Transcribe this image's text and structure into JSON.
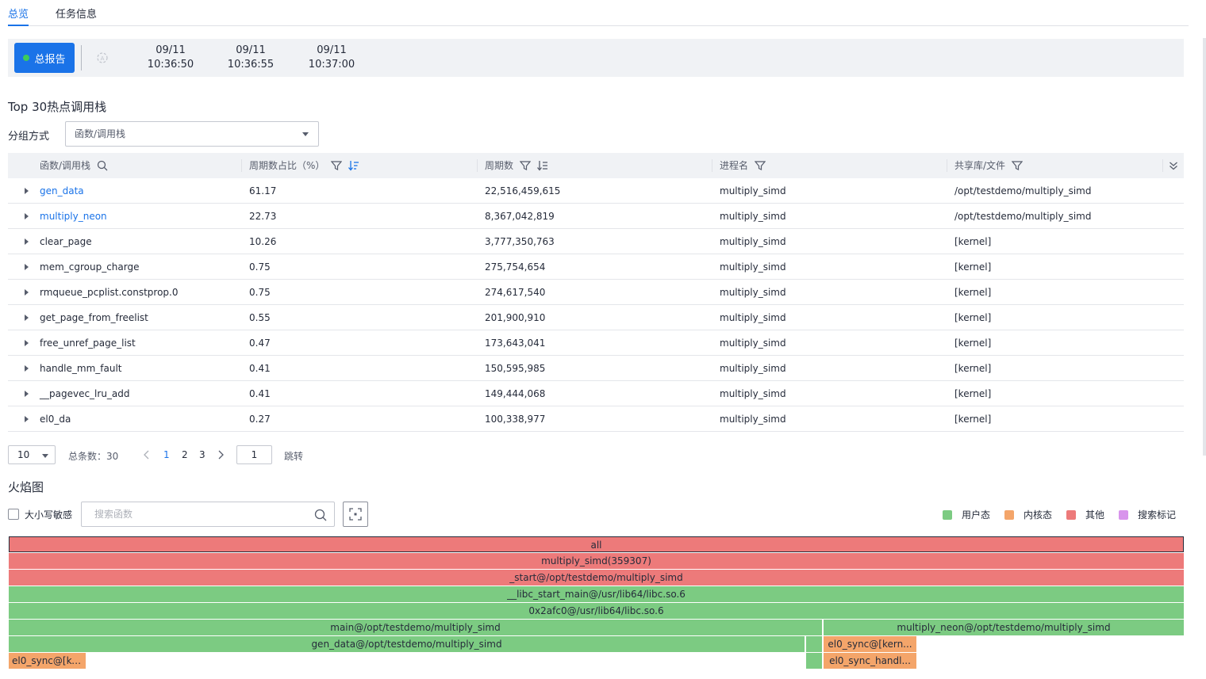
{
  "tabs": [
    {
      "label": "总览",
      "active": true
    },
    {
      "label": "任务信息",
      "active": false
    }
  ],
  "timeline": {
    "report_button": "总报告",
    "icon": "auto-icon",
    "points": [
      {
        "date": "09/11",
        "time": "10:36:50"
      },
      {
        "date": "09/11",
        "time": "10:36:55"
      },
      {
        "date": "09/11",
        "time": "10:37:00"
      }
    ]
  },
  "hotspot": {
    "title": "Top 30热点调用栈",
    "group_label": "分组方式",
    "group_value": "函数/调用栈",
    "columns": [
      "函数/调用栈",
      "周期数占比（%）",
      "周期数",
      "进程名",
      "共享库/文件"
    ],
    "rows": [
      {
        "func": "gen_data",
        "pct": "61.17",
        "cycles": "22,516,459,615",
        "proc": "multiply_simd",
        "lib": "/opt/testdemo/multiply_simd",
        "link": true
      },
      {
        "func": "multiply_neon",
        "pct": "22.73",
        "cycles": "8,367,042,819",
        "proc": "multiply_simd",
        "lib": "/opt/testdemo/multiply_simd",
        "link": true
      },
      {
        "func": "clear_page",
        "pct": "10.26",
        "cycles": "3,777,350,763",
        "proc": "multiply_simd",
        "lib": "[kernel]",
        "link": false
      },
      {
        "func": "mem_cgroup_charge",
        "pct": "0.75",
        "cycles": "275,754,654",
        "proc": "multiply_simd",
        "lib": "[kernel]",
        "link": false
      },
      {
        "func": "rmqueue_pcplist.constprop.0",
        "pct": "0.75",
        "cycles": "274,617,540",
        "proc": "multiply_simd",
        "lib": "[kernel]",
        "link": false
      },
      {
        "func": "get_page_from_freelist",
        "pct": "0.55",
        "cycles": "201,900,910",
        "proc": "multiply_simd",
        "lib": "[kernel]",
        "link": false
      },
      {
        "func": "free_unref_page_list",
        "pct": "0.47",
        "cycles": "173,643,041",
        "proc": "multiply_simd",
        "lib": "[kernel]",
        "link": false
      },
      {
        "func": "handle_mm_fault",
        "pct": "0.41",
        "cycles": "150,595,985",
        "proc": "multiply_simd",
        "lib": "[kernel]",
        "link": false
      },
      {
        "func": "__pagevec_lru_add",
        "pct": "0.41",
        "cycles": "149,444,068",
        "proc": "multiply_simd",
        "lib": "[kernel]",
        "link": false
      },
      {
        "func": "el0_da",
        "pct": "0.27",
        "cycles": "100,338,977",
        "proc": "multiply_simd",
        "lib": "[kernel]",
        "link": false
      }
    ]
  },
  "pagination": {
    "page_size": "10",
    "total": "总条数：30",
    "pages": [
      "1",
      "2",
      "3"
    ],
    "current": "1",
    "jump_value": "1",
    "jump_label": "跳转"
  },
  "flame": {
    "title": "火焰图",
    "case_label": "大小写敏感",
    "search_placeholder": "搜索函数",
    "legend": [
      {
        "label": "用户态",
        "color": "#7ccb82"
      },
      {
        "label": "内核态",
        "color": "#f4a56a"
      },
      {
        "label": "其他",
        "color": "#ed7a7a"
      },
      {
        "label": "搜索标记",
        "color": "#d894ec"
      }
    ],
    "frames": [
      {
        "label": "all",
        "kind": "other"
      },
      {
        "label": "multiply_simd(359307)",
        "kind": "other"
      },
      {
        "label": "_start@/opt/testdemo/multiply_simd",
        "kind": "other"
      },
      {
        "label": "__libc_start_main@/usr/lib64/libc.so.6",
        "kind": "user"
      },
      {
        "label": "0x2afc0@/usr/lib64/libc.so.6",
        "kind": "user"
      },
      {
        "label": "main@/opt/testdemo/multiply_simd",
        "kind": "user"
      },
      {
        "label": "multiply_neon@/opt/testdemo/multiply_simd",
        "kind": "user"
      },
      {
        "label": "gen_data@/opt/testdemo/multiply_simd",
        "kind": "user"
      },
      {
        "label": "",
        "kind": "user"
      },
      {
        "label": "el0_sync@[kern...",
        "kind": "kernel"
      },
      {
        "label": "el0_sync@[ke...",
        "kind": "kernel"
      },
      {
        "label": "",
        "kind": "user"
      },
      {
        "label": "el0_sync_handl...",
        "kind": "kernel"
      }
    ]
  }
}
